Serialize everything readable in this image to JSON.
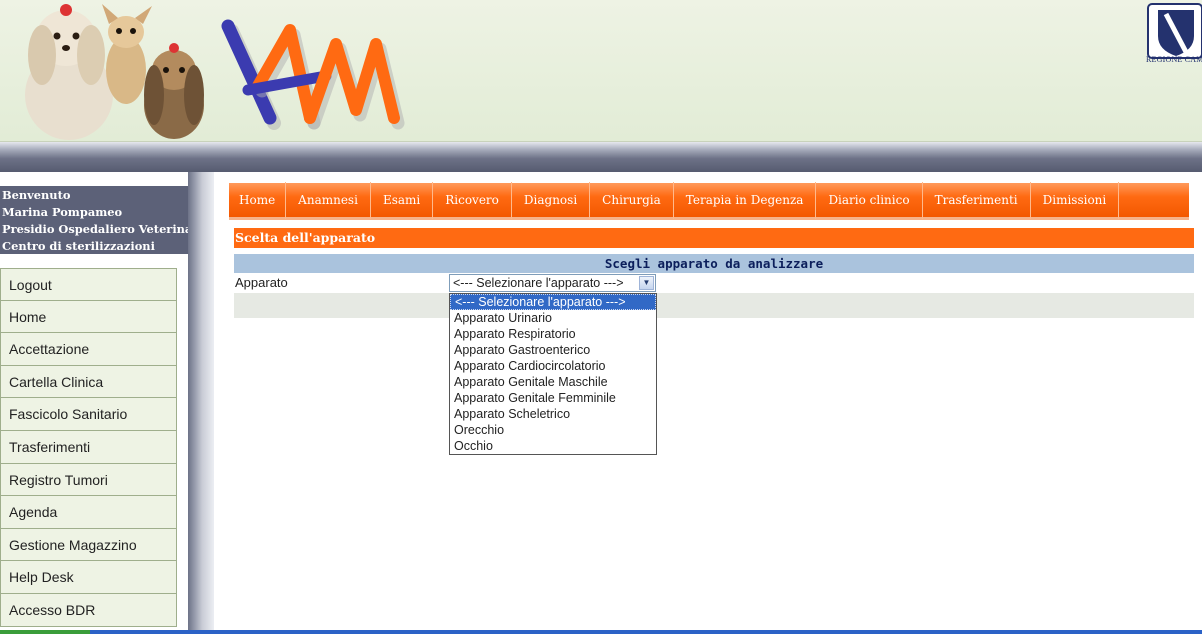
{
  "header": {
    "dogs_image": "dogs-photo",
    "app_logo": "vam-logo",
    "region_logo_text": "REGIONE CAMPANIA",
    "colors": {
      "logo_blue": "#3b3bb0",
      "logo_orange": "#ff6a12"
    }
  },
  "sidebar": {
    "welcome": [
      "Benvenuto",
      "Marina Pompameo",
      "Presidio Ospedaliero Veterinario",
      "Centro di sterilizzazioni"
    ],
    "menu": [
      "Logout",
      "Home",
      "Accettazione",
      "Cartella Clinica",
      "Fascicolo Sanitario",
      "Trasferimenti",
      "Registro Tumori",
      "Agenda",
      "Gestione Magazzino",
      "Help Desk",
      "Accesso BDR"
    ]
  },
  "tabs": [
    "Home",
    "Anamnesi",
    "Esami",
    "Ricovero",
    "Diagnosi",
    "Chirurgia",
    "Terapia in Degenza",
    "Diario clinico",
    "Trasferimenti",
    "Dimissioni"
  ],
  "content": {
    "section_title": "Scelta dell'apparato",
    "form_header": "Scegli apparato da analizzare",
    "field_label": "Apparato",
    "select_value": "<--- Selezionare l'apparato --->",
    "options": [
      "<--- Selezionare l'apparato --->",
      "Apparato Urinario",
      "Apparato Respiratorio",
      "Apparato Gastroenterico",
      "Apparato Cardiocircolatorio",
      "Apparato Genitale Maschile",
      "Apparato Genitale Femminile",
      "Apparato Scheletrico",
      "Orecchio",
      "Occhio"
    ],
    "selected_index": 0
  },
  "theme": {
    "accent": "#ff6a12",
    "header_bg": "#e2ecd6",
    "sidebar_bg": "#eef3e4",
    "welcome_bg": "#5c6178",
    "form_header_bg": "#aac3dd"
  }
}
